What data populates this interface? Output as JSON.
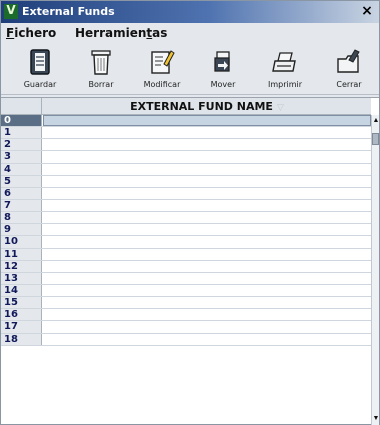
{
  "window": {
    "title": "External Funds",
    "app_icon_glyph": "V",
    "close_glyph": "×"
  },
  "menu": {
    "items": [
      {
        "label_underlined": "F",
        "label_rest": "ichero"
      },
      {
        "label_before": "Herramien",
        "label_underlined": "t",
        "label_rest": "as"
      }
    ]
  },
  "toolbar": {
    "buttons": [
      {
        "label": "Guardar",
        "icon": "save-icon"
      },
      {
        "label": "Borrar",
        "icon": "trash-icon"
      },
      {
        "label": "Modificar",
        "icon": "edit-icon"
      },
      {
        "label": "Mover",
        "icon": "move-icon"
      },
      {
        "label": "Imprimir",
        "icon": "printer-icon"
      },
      {
        "label": "Cerrar",
        "icon": "close-folder-icon"
      }
    ]
  },
  "grid": {
    "column_header": "EXTERNAL FUND NAME",
    "sort_glyph": "▽",
    "selected_row": 0,
    "row_numbers": [
      "0",
      "1",
      "2",
      "3",
      "4",
      "5",
      "6",
      "7",
      "8",
      "9",
      "10",
      "11",
      "12",
      "13",
      "14",
      "15",
      "16",
      "17",
      "18"
    ]
  },
  "scrollbar": {
    "up_glyph": "▲",
    "down_glyph": "▼"
  },
  "colors": {
    "title_gradient_start": "#1f3f7a",
    "window_bg": "#e4e8ec",
    "selected_row": "#c7d4e2"
  }
}
